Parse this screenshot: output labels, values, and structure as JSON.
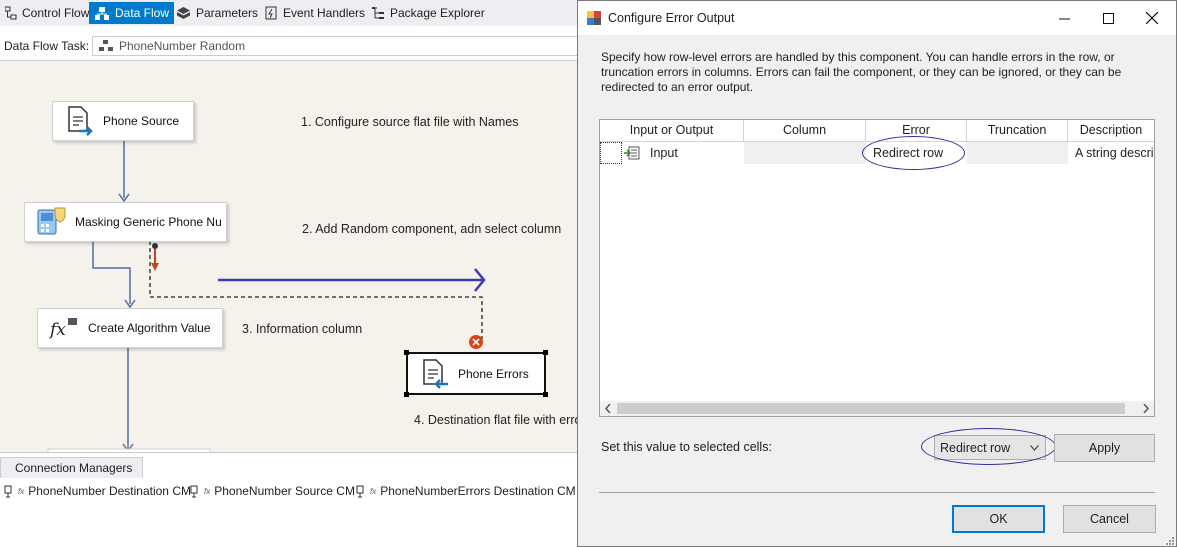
{
  "tabs": [
    {
      "label": "Control Flow",
      "icon": "control-flow-icon"
    },
    {
      "label": "Data Flow",
      "icon": "data-flow-icon",
      "active": true
    },
    {
      "label": "Parameters",
      "icon": "parameters-icon"
    },
    {
      "label": "Event Handlers",
      "icon": "event-handlers-icon"
    },
    {
      "label": "Package Explorer",
      "icon": "package-explorer-icon"
    }
  ],
  "task": {
    "label": "Data Flow Task:",
    "value": "PhoneNumber Random"
  },
  "nodes": {
    "source": "Phone Source",
    "masking": "Masking Generic Phone Nu",
    "algorithm": "Create Algorithm Value",
    "errors": "Phone Errors"
  },
  "notes": {
    "n1": "1. Configure source flat file with Names",
    "n2": "2. Add Random component, adn select column",
    "n3": "3. Information column",
    "n4": "4. Destination flat file with erro"
  },
  "connection_managers": {
    "tab": "Connection Managers",
    "items": [
      "PhoneNumber Destination CM",
      "PhoneNumber Source CM",
      "PhoneNumberErrors Destination CM"
    ]
  },
  "dialog": {
    "title": "Configure Error Output",
    "description": "Specify how row-level errors are handled by this component. You can handle errors in the row, or truncation errors in columns. Errors can fail the component, or they can be ignored, or they can be redirected to an error output.",
    "columns": [
      "Input or Output",
      "Column",
      "Error",
      "Truncation",
      "Description"
    ],
    "rows": [
      {
        "io": "Input",
        "column": "",
        "error": "Redirect row",
        "truncation": "",
        "description": "A string descri..."
      }
    ],
    "set_label": "Set this value to selected cells:",
    "set_value": "Redirect row",
    "apply": "Apply",
    "ok": "OK",
    "cancel": "Cancel"
  },
  "colors": {
    "accent": "#007acc",
    "path": "#4f6fa3",
    "annotation": "#2e2e9e",
    "error_path": "#c1441c"
  }
}
